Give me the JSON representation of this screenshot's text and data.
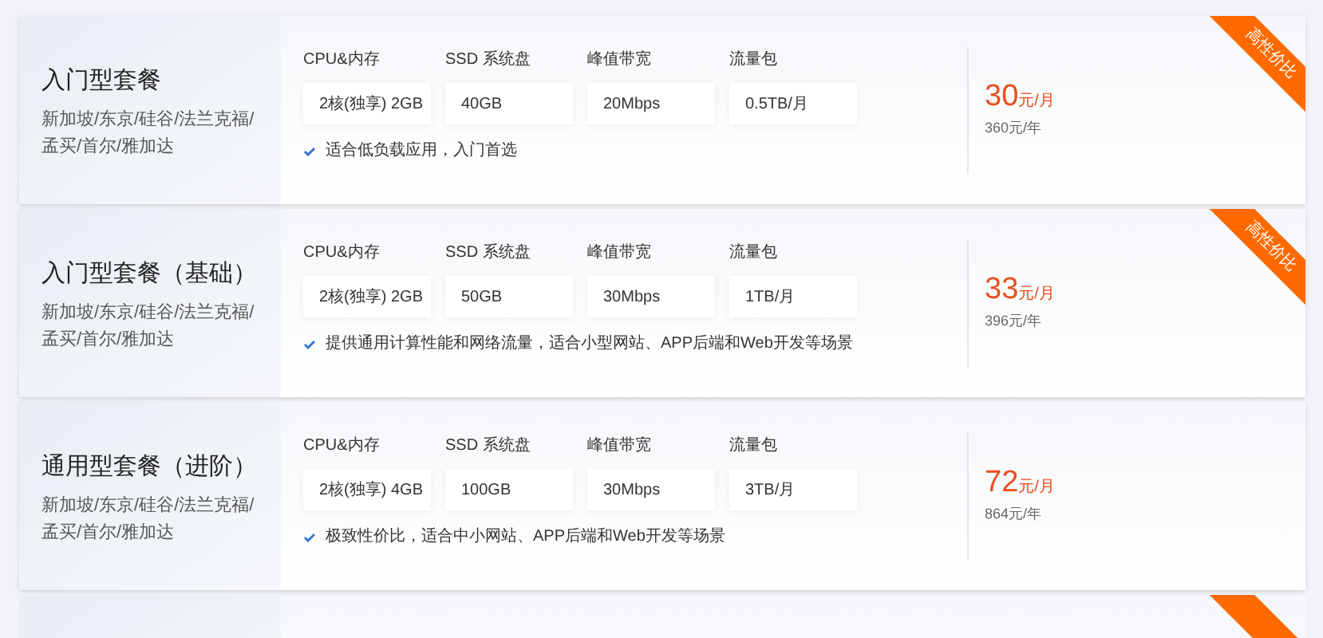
{
  "plans": [
    {
      "name": "入门型套餐",
      "regions": "新加坡/东京/硅谷/法兰克福/孟买/首尔/雅加达",
      "specs": [
        {
          "label": "CPU&内存",
          "value": "2核(独享) 2GB"
        },
        {
          "label": "SSD 系统盘",
          "value": "40GB"
        },
        {
          "label": "峰值带宽",
          "value": "20Mbps"
        },
        {
          "label": "流量包",
          "value": "0.5TB/月"
        }
      ],
      "note": "适合低负载应用，入门首选",
      "price": "30",
      "price_unit": "元/月",
      "yearly": "360元/年",
      "ribbon": "高性价比"
    },
    {
      "name": "入门型套餐（基础）",
      "regions": "新加坡/东京/硅谷/法兰克福/孟买/首尔/雅加达",
      "specs": [
        {
          "label": "CPU&内存",
          "value": "2核(独享) 2GB"
        },
        {
          "label": "SSD 系统盘",
          "value": "50GB"
        },
        {
          "label": "峰值带宽",
          "value": "30Mbps"
        },
        {
          "label": "流量包",
          "value": "1TB/月"
        }
      ],
      "note": "提供通用计算性能和网络流量，适合小型网站、APP后端和Web开发等场景",
      "price": "33",
      "price_unit": "元/月",
      "yearly": "396元/年",
      "ribbon": "高性价比"
    },
    {
      "name": "通用型套餐（进阶）",
      "regions": "新加坡/东京/硅谷/法兰克福/孟买/首尔/雅加达",
      "specs": [
        {
          "label": "CPU&内存",
          "value": "2核(独享) 4GB"
        },
        {
          "label": "SSD 系统盘",
          "value": "100GB"
        },
        {
          "label": "峰值带宽",
          "value": "30Mbps"
        },
        {
          "label": "流量包",
          "value": "3TB/月"
        }
      ],
      "note": "极致性价比，适合中小网站、APP后端和Web开发等场景",
      "price": "72",
      "price_unit": "元/月",
      "yearly": "864元/年"
    }
  ]
}
